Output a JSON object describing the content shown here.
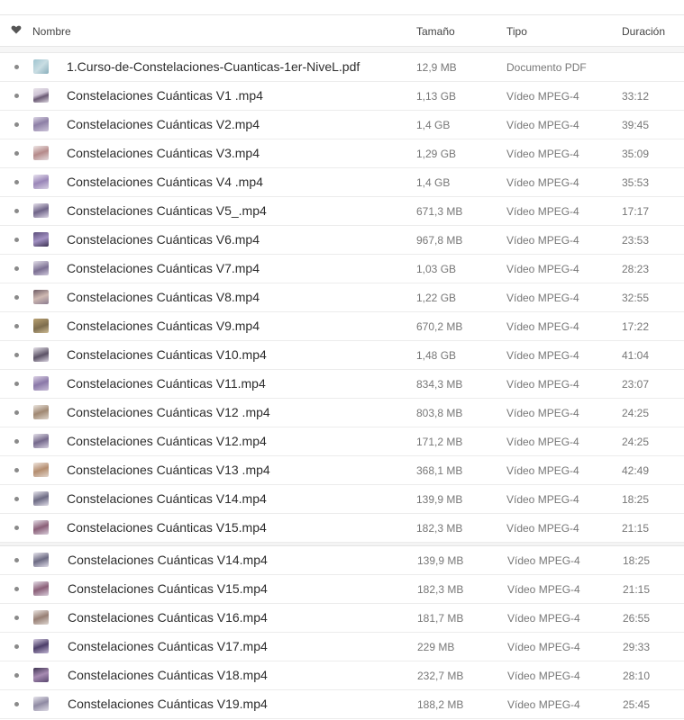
{
  "header": {
    "favorite_icon": "heart-icon",
    "name": "Nombre",
    "size": "Tamaño",
    "type": "Tipo",
    "duration": "Duración"
  },
  "files": [
    {
      "name": "1.Curso-de-Constelaciones-Cuanticas-1er-NiveL.pdf",
      "size": "12,9 MB",
      "type": "Documento PDF",
      "duration": "",
      "thumb": "t-pdf"
    },
    {
      "name": "Constelaciones Cuánticas V1 .mp4",
      "size": "1,13 GB",
      "type": "Vídeo MPEG-4",
      "duration": "33:12",
      "thumb": "t-v1"
    },
    {
      "name": "Constelaciones Cuánticas V2.mp4",
      "size": "1,4 GB",
      "type": "Vídeo MPEG-4",
      "duration": "39:45",
      "thumb": "t-v2"
    },
    {
      "name": "Constelaciones Cuánticas V3.mp4",
      "size": "1,29 GB",
      "type": "Vídeo MPEG-4",
      "duration": "35:09",
      "thumb": "t-v3"
    },
    {
      "name": "Constelaciones Cuánticas V4 .mp4",
      "size": "1,4 GB",
      "type": "Vídeo MPEG-4",
      "duration": "35:53",
      "thumb": "t-v4"
    },
    {
      "name": "Constelaciones Cuánticas V5_.mp4",
      "size": "671,3 MB",
      "type": "Vídeo MPEG-4",
      "duration": "17:17",
      "thumb": "t-v5"
    },
    {
      "name": "Constelaciones Cuánticas V6.mp4",
      "size": "967,8 MB",
      "type": "Vídeo MPEG-4",
      "duration": "23:53",
      "thumb": "t-v6"
    },
    {
      "name": "Constelaciones Cuánticas V7.mp4",
      "size": "1,03 GB",
      "type": "Vídeo MPEG-4",
      "duration": "28:23",
      "thumb": "t-v7"
    },
    {
      "name": "Constelaciones Cuánticas V8.mp4",
      "size": "1,22 GB",
      "type": "Vídeo MPEG-4",
      "duration": "32:55",
      "thumb": "t-v8"
    },
    {
      "name": "Constelaciones Cuánticas V9.mp4",
      "size": "670,2 MB",
      "type": "Vídeo MPEG-4",
      "duration": "17:22",
      "thumb": "t-v9"
    },
    {
      "name": "Constelaciones Cuánticas V10.mp4",
      "size": "1,48 GB",
      "type": "Vídeo MPEG-4",
      "duration": "41:04",
      "thumb": "t-v10"
    },
    {
      "name": "Constelaciones Cuánticas V11.mp4",
      "size": "834,3 MB",
      "type": "Vídeo MPEG-4",
      "duration": "23:07",
      "thumb": "t-v11"
    },
    {
      "name": "Constelaciones Cuánticas V12 .mp4",
      "size": "803,8 MB",
      "type": "Vídeo MPEG-4",
      "duration": "24:25",
      "thumb": "t-v12"
    },
    {
      "name": "Constelaciones Cuánticas V12.mp4",
      "size": "171,2 MB",
      "type": "Vídeo MPEG-4",
      "duration": "24:25",
      "thumb": "t-v12b"
    },
    {
      "name": "Constelaciones Cuánticas V13 .mp4",
      "size": "368,1 MB",
      "type": "Vídeo MPEG-4",
      "duration": "42:49",
      "thumb": "t-v13"
    },
    {
      "name": "Constelaciones Cuánticas V14.mp4",
      "size": "139,9 MB",
      "type": "Vídeo MPEG-4",
      "duration": "18:25",
      "thumb": "t-v14"
    },
    {
      "name": "Constelaciones Cuánticas V15.mp4",
      "size": "182,3 MB",
      "type": "Vídeo MPEG-4",
      "duration": "21:15",
      "thumb": "t-v15"
    },
    {
      "name": "Constelaciones Cuánticas V14.mp4",
      "size": "139,9 MB",
      "type": "Vídeo MPEG-4",
      "duration": "18:25",
      "thumb": "t-v14"
    },
    {
      "name": "Constelaciones Cuánticas V15.mp4",
      "size": "182,3 MB",
      "type": "Vídeo MPEG-4",
      "duration": "21:15",
      "thumb": "t-v15"
    },
    {
      "name": "Constelaciones Cuánticas V16.mp4",
      "size": "181,7 MB",
      "type": "Vídeo MPEG-4",
      "duration": "26:55",
      "thumb": "t-v16"
    },
    {
      "name": "Constelaciones Cuánticas V17.mp4",
      "size": "229 MB",
      "type": "Vídeo MPEG-4",
      "duration": "29:33",
      "thumb": "t-v17"
    },
    {
      "name": "Constelaciones Cuánticas V18.mp4",
      "size": "232,7 MB",
      "type": "Vídeo MPEG-4",
      "duration": "28:10",
      "thumb": "t-v18"
    },
    {
      "name": "Constelaciones Cuánticas V19.mp4",
      "size": "188,2 MB",
      "type": "Vídeo MPEG-4",
      "duration": "25:45",
      "thumb": "t-v19"
    }
  ]
}
